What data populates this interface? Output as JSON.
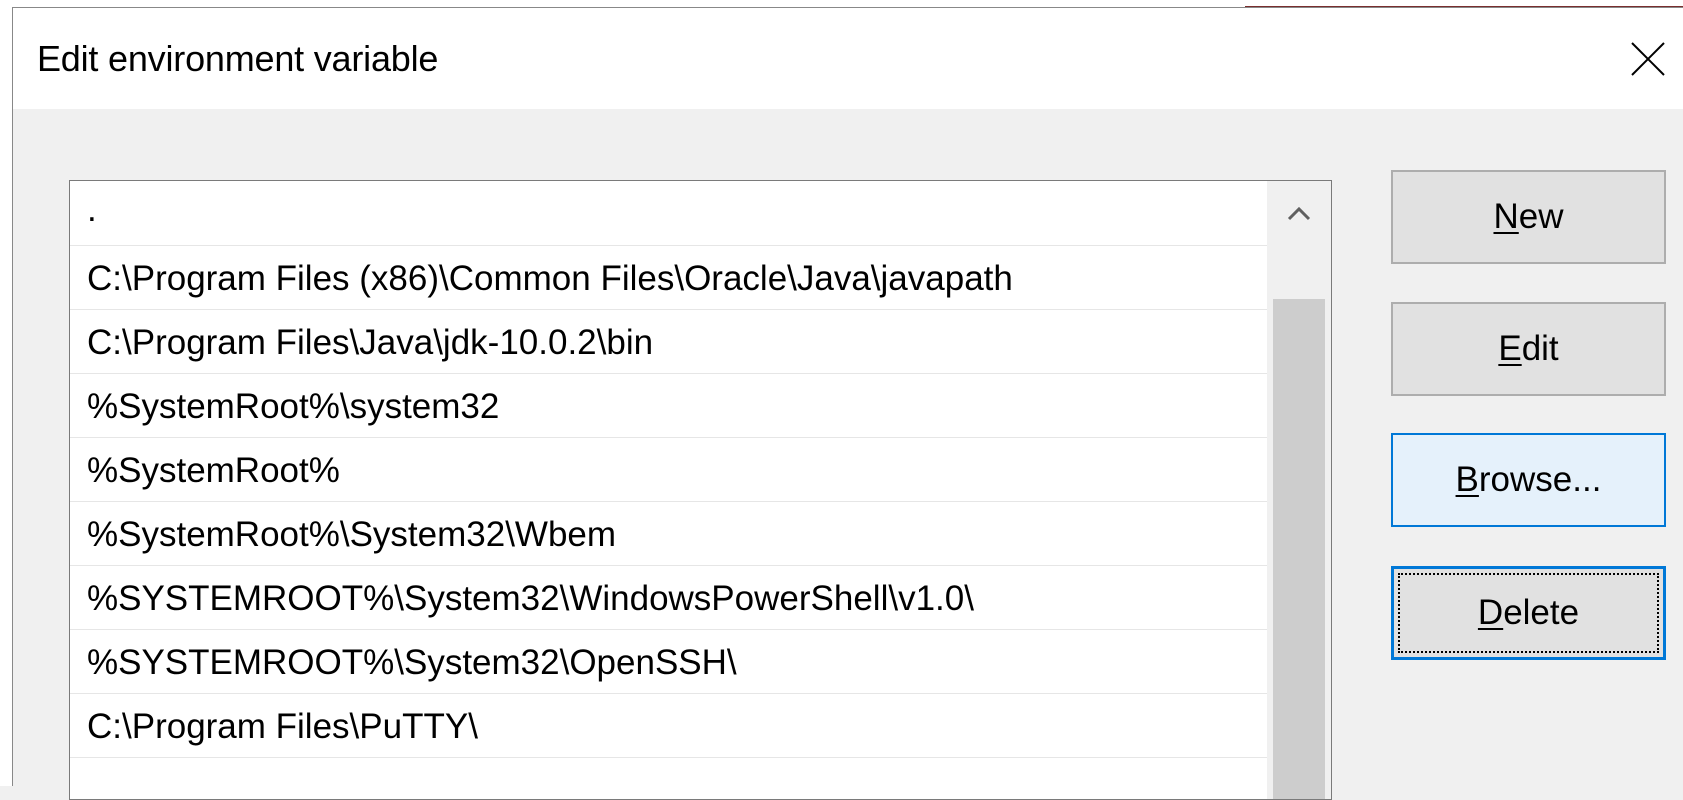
{
  "window": {
    "title": "Edit environment variable",
    "close_icon": "close-icon"
  },
  "list": {
    "items": [
      ".",
      "C:\\Program Files (x86)\\Common Files\\Oracle\\Java\\javapath",
      "C:\\Program Files\\Java\\jdk-10.0.2\\bin",
      "%SystemRoot%\\system32",
      "%SystemRoot%",
      "%SystemRoot%\\System32\\Wbem",
      "%SYSTEMROOT%\\System32\\WindowsPowerShell\\v1.0\\",
      "%SYSTEMROOT%\\System32\\OpenSSH\\",
      "C:\\Program Files\\PuTTY\\"
    ],
    "scroll_up_icon": "chevron-up-icon"
  },
  "buttons": {
    "new": {
      "accel": "N",
      "rest": "ew"
    },
    "edit": {
      "accel": "E",
      "rest": "dit"
    },
    "browse": {
      "accel": "B",
      "rest": "rowse..."
    },
    "delete": {
      "accel": "D",
      "rest": "elete"
    }
  },
  "colors": {
    "focus_border": "#0078d7",
    "hover_background": "#e5f1fb",
    "button_background": "#e1e1e1"
  }
}
